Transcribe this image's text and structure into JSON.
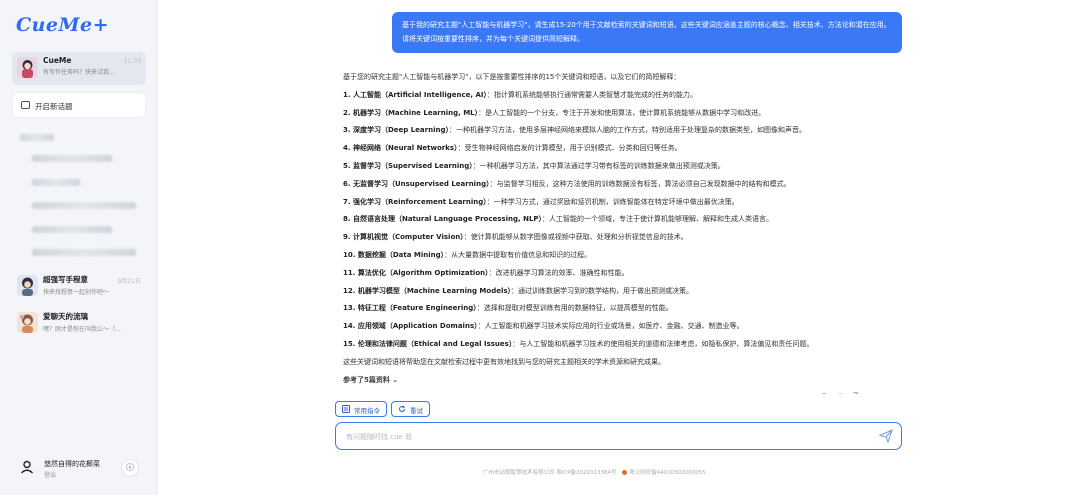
{
  "app": {
    "logo": "CueMe+"
  },
  "sidebar": {
    "chats": [
      {
        "name": "CueMe",
        "preview": "有写作任务吗？快来试我...",
        "time": "11:33",
        "active": true
      },
      {
        "name": "超强写手程意",
        "preview": "快来找程意一起创作吧～",
        "time": "9月21日"
      },
      {
        "name": "爱聊天的流璃",
        "preview": "嘿？刚才是你在叫我么～（...",
        "time": ""
      }
    ],
    "new_chat_label": "开启新话题",
    "user": {
      "name": "悠然自得的花椰菜",
      "logout": "登出"
    }
  },
  "conversation": {
    "user_message": "基于我的研究主题\"人工智能与机器学习\"，请生成15-20个用于文献检索的关键词和短语。这些关键词应涵盖主题的核心概念、相关技术、方法论和潜在应用。请将关键词按重要性排序，并为每个关键词提供简短解释。",
    "answer_intro": "基于您的研究主题\"人工智能与机器学习\"，以下是按重要性排序的15个关键词和短语，以及它们的简短解释：",
    "keywords": [
      {
        "term": "1. 人工智能（Artificial Intelligence, AI）",
        "desc": "：指计算机系统能够执行通常需要人类智慧才能完成的任务的能力。"
      },
      {
        "term": "2. 机器学习（Machine Learning, ML）",
        "desc": "：是人工智能的一个分支，专注于开发和使用算法，使计算机系统能够从数据中学习和改进。"
      },
      {
        "term": "3. 深度学习（Deep Learning）",
        "desc": "：一种机器学习方法，使用多层神经网络来模拟人脑的工作方式，特别适用于处理复杂的数据类型，如图像和声音。"
      },
      {
        "term": "4. 神经网络（Neural Networks）",
        "desc": "：受生物神经网络启发的计算模型，用于识别模式、分类和回归等任务。"
      },
      {
        "term": "5. 监督学习（Supervised Learning）",
        "desc": "：一种机器学习方法，其中算法通过学习带有标签的训练数据来做出预测或决策。"
      },
      {
        "term": "6. 无监督学习（Unsupervised Learning）",
        "desc": "：与监督学习相反，这种方法使用的训练数据没有标签，算法必须自己发现数据中的结构和模式。"
      },
      {
        "term": "7. 强化学习（Reinforcement Learning）",
        "desc": "：一种学习方式，通过奖励和惩罚机制，训练智能体在特定环境中做出最优决策。"
      },
      {
        "term": "8. 自然语言处理（Natural Language Processing, NLP）",
        "desc": "：人工智能的一个领域，专注于使计算机能够理解、解释和生成人类语言。"
      },
      {
        "term": "9. 计算机视觉（Computer Vision）",
        "desc": "：使计算机能够从数字图像或视频中获取、处理和分析视觉信息的技术。"
      },
      {
        "term": "10. 数据挖掘（Data Mining）",
        "desc": "：从大量数据中提取有价值信息和知识的过程。"
      },
      {
        "term": "11. 算法优化（Algorithm Optimization）",
        "desc": "：改进机器学习算法的效率、准确性和性能。"
      },
      {
        "term": "12. 机器学习模型（Machine Learning Models）",
        "desc": "：通过训练数据学习到的数学结构，用于做出预测或决策。"
      },
      {
        "term": "13. 特征工程（Feature Engineering）",
        "desc": "：选择和提取对模型训练有用的数据特征，以提高模型的性能。"
      },
      {
        "term": "14. 应用领域（Application Domains）",
        "desc": "：人工智能和机器学习技术实际应用的行业或场景，如医疗、金融、交通、制造业等。"
      },
      {
        "term": "15. 伦理和法律问题（Ethical and Legal Issues）",
        "desc": "：与人工智能和机器学习技术的使用相关的道德和法律考虑，如隐私保护、算法偏见和责任问题。"
      }
    ],
    "answer_outro": "这些关键词和短语将帮助您在文献检索过程中更有效地找到与您的研究主题相关的学术资源和研究成果。",
    "source_label": "参考了5篇资料"
  },
  "actions": {
    "common_prompts": "常用指令",
    "retry": "重试"
  },
  "input": {
    "placeholder": "有问题随时找 cue 我"
  },
  "footer": {
    "icp": "广州市动观智慧技术有限公司 粤ICP备2022013384号",
    "police": "粤公网安备44010502000055"
  },
  "colors": {
    "accent": "#3a78f5",
    "logo": "#2f6bf2"
  }
}
